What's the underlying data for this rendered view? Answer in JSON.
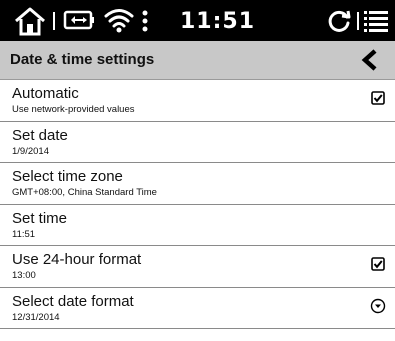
{
  "status": {
    "time": "11:51"
  },
  "header": {
    "title": "Date & time settings"
  },
  "settings": [
    {
      "label": "Automatic",
      "sub": "Use network-provided values",
      "control": "checkbox",
      "checked": true
    },
    {
      "label": "Set date",
      "sub": "1/9/2014",
      "control": "none"
    },
    {
      "label": "Select time zone",
      "sub": "GMT+08:00, China Standard Time",
      "control": "none"
    },
    {
      "label": "Set time",
      "sub": "11:51",
      "control": "none"
    },
    {
      "label": "Use 24-hour format",
      "sub": "13:00",
      "control": "checkbox",
      "checked": true
    },
    {
      "label": "Select date format",
      "sub": "12/31/2014",
      "control": "dropdown"
    }
  ],
  "icons": {
    "home": "home-icon",
    "battery": "battery-icon",
    "wifi": "wifi-icon",
    "overflow": "overflow-menu-icon",
    "refresh": "refresh-icon",
    "menu": "menu-icon",
    "back": "back-icon",
    "checkbox": "checkbox-checked-icon",
    "dropdown": "dropdown-icon"
  }
}
